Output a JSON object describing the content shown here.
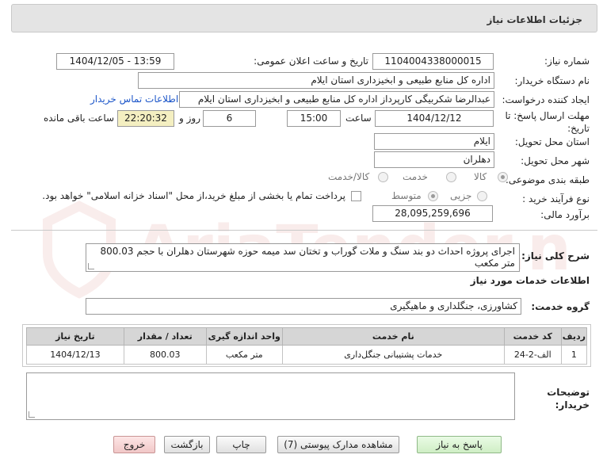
{
  "header": {
    "title": "جزئیات اطلاعات نیاز"
  },
  "fields": {
    "need_number_label": "شماره نیاز:",
    "need_number": "1104004338000015",
    "announce_label": "تاریخ و ساعت اعلان عمومی:",
    "announce_value": "1404/12/05 - 13:59",
    "buyer_org_label": "نام دستگاه خریدار:",
    "buyer_org": "اداره کل منابع طبیعی و ابخیزداری استان ایلام",
    "creator_label": "ایجاد کننده درخواست:",
    "creator": "عبدالرضا شکربیگی کارپرداز اداره کل منابع طبیعی و ابخیزداری استان ایلام",
    "contact_link": "اطلاعات تماس خریدار",
    "deadline_label": "مهلت ارسال پاسخ: تا تاریخ:",
    "deadline_date": "1404/12/12",
    "hour_label": "ساعت",
    "deadline_time": "15:00",
    "days_value": "6",
    "days_label": "روز و",
    "remaining_time": "22:20:32",
    "remaining_label": "ساعت باقی مانده",
    "province_label": "استان محل تحویل:",
    "province": "ایلام",
    "city_label": "شهر محل تحویل:",
    "city": "دهلران",
    "category_label": "طبقه بندی موضوعی:",
    "category_options": [
      "کالا",
      "خدمت",
      "کالا/خدمت"
    ],
    "process_label": "نوع فرآیند خرید :",
    "process_options": [
      "جزیی",
      "متوسط"
    ],
    "payment_note": "پرداخت تمام یا بخشی از مبلغ خرید،از محل \"اسناد خزانه اسلامی\" خواهد بود.",
    "estimate_label": "برآورد مالی:",
    "estimate": "28,095,259,696"
  },
  "description": {
    "label": "شرح کلی نیاز:",
    "text": "اجرای پروژه احداث دو بند سنگ و ملات گوراب و تختان سد میمه حوزه شهرستان دهلران با حجم 800.03 متر مکعب"
  },
  "services": {
    "section_title": "اطلاعات خدمات مورد نیاز",
    "group_label": "گروه خدمت:",
    "group_value": "کشاورزی، جنگلداری و ماهیگیری",
    "columns": [
      "ردیف",
      "کد خدمت",
      "نام خدمت",
      "واحد اندازه گیری",
      "تعداد / مقدار",
      "تاریخ نیاز"
    ],
    "rows": [
      [
        "1",
        "الف-2-24",
        "خدمات پشتیبانی جنگل‌داری",
        "متر مکعب",
        "800.03",
        "1404/12/13"
      ]
    ]
  },
  "buyer_notes": {
    "label": "توضیحات خریدار:",
    "text": ""
  },
  "buttons": {
    "reply": "پاسخ به نیاز",
    "attachments": "مشاهده مدارک پیوستی (7)",
    "print": "چاپ",
    "back": "بازگشت",
    "exit": "خروج"
  },
  "watermark": {
    "text": "AriaTender.net"
  },
  "colors": {
    "link": "#1c56c9",
    "yellow_field": "#f4efc1",
    "header_bg": "#e4e4e4"
  }
}
